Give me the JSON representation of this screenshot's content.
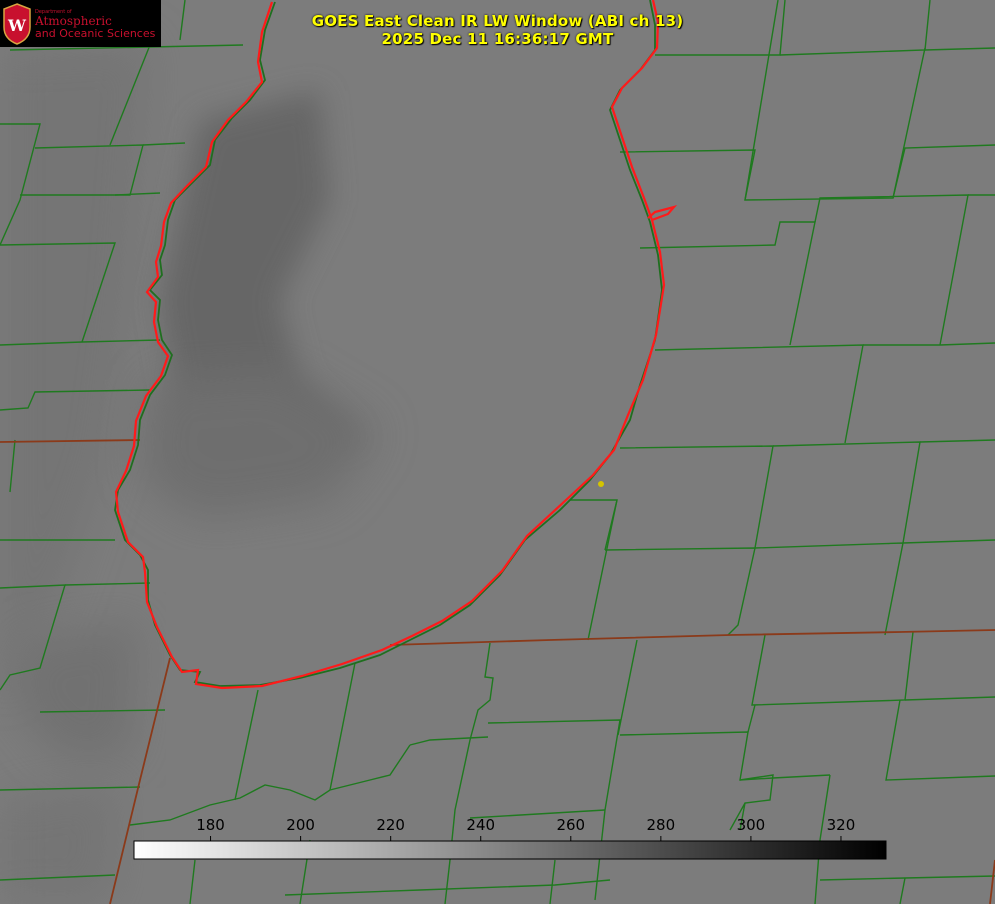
{
  "logo": {
    "department": "Department of",
    "line1": "Atmospheric",
    "line2": "and Oceanic Sciences",
    "crest_letter": "W"
  },
  "title": {
    "line1": "GOES East Clean IR LW Window (ABI ch 13)",
    "line2": "2025 Dec 11 16:36:17 GMT"
  },
  "colorbar": {
    "min": 163,
    "max": 330,
    "ticks": [
      "180",
      "200",
      "220",
      "240",
      "260",
      "280",
      "300",
      "320"
    ],
    "gradient": [
      "#ffffff",
      "#000000"
    ]
  },
  "colors": {
    "background": "#7c7c7c",
    "county_lines": "#1f7a1f",
    "shoreline": "#ff1a1a",
    "state_lines": "#8b3a1a",
    "title_text": "#ffff00",
    "marker": "#d4c400"
  }
}
